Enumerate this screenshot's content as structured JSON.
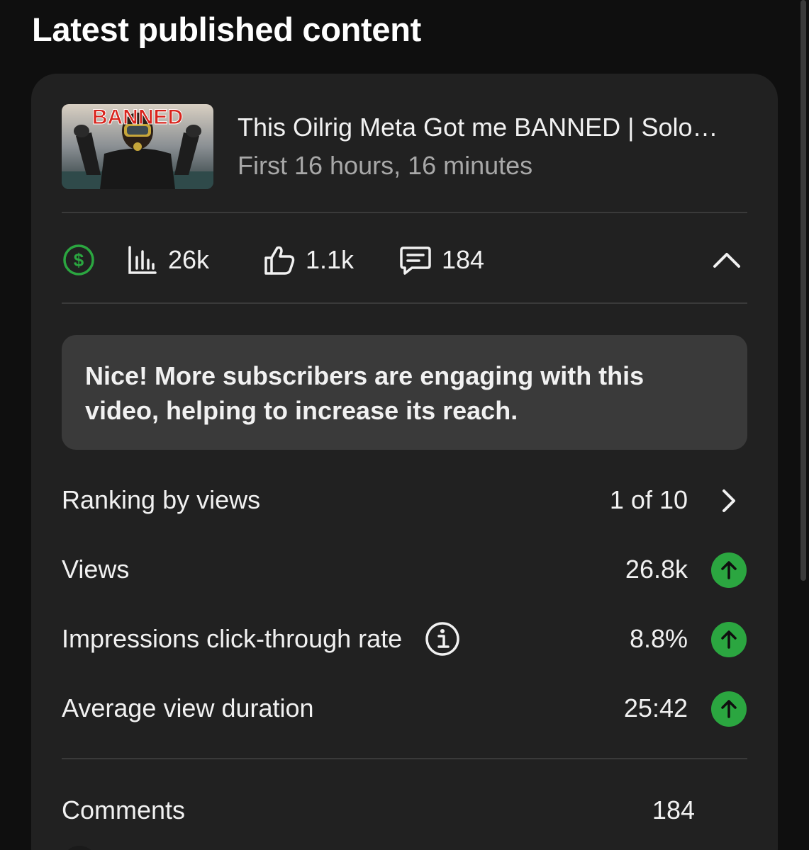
{
  "header": {
    "title": "Latest published content"
  },
  "video": {
    "thumbnail_text": "BANNED",
    "title": "This Oilrig Meta Got me BANNED | Solo…",
    "period": "First 16 hours, 16 minutes"
  },
  "stats": {
    "views": "26k",
    "likes": "1.1k",
    "comments": "184",
    "monetization_color": "#2ba640"
  },
  "insight": {
    "text": "Nice! More subscribers are engaging with this video, helping to increase its reach."
  },
  "metrics": [
    {
      "label": "Ranking by views",
      "value": "1 of 10",
      "trail": "chevron-right"
    },
    {
      "label": "Views",
      "value": "26.8k",
      "trail": "up-arrow"
    },
    {
      "label": "Impressions click-through rate",
      "value": "8.8%",
      "trail": "up-arrow"
    },
    {
      "label": "Average view duration",
      "value": "25:42",
      "trail": "up-arrow"
    }
  ],
  "comments_section": {
    "label": "Comments",
    "count": "184"
  },
  "colors": {
    "background": "#0f0f0f",
    "card": "#212121",
    "insight_bg": "#3a3a3a",
    "positive": "#2ba640"
  }
}
